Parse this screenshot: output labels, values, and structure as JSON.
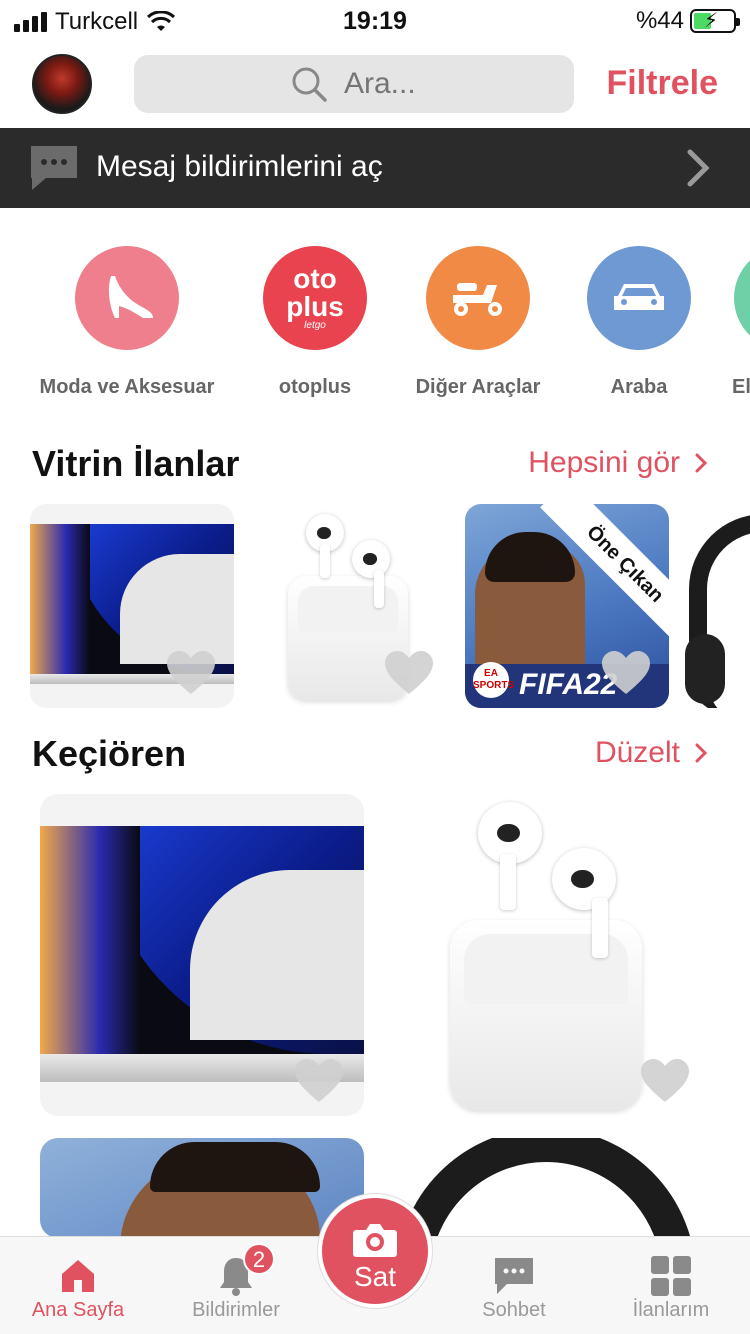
{
  "status_bar": {
    "carrier": "Turkcell",
    "time": "19:19",
    "battery": "%44"
  },
  "topbar": {
    "search_placeholder": "Ara...",
    "filter_label": "Filtrele"
  },
  "banner": {
    "text": "Mesaj bildirimlerini aç"
  },
  "categories": [
    {
      "label": "Moda ve Aksesuar",
      "color": "#ef7f8c",
      "icon": "high-heel-icon"
    },
    {
      "label": "otoplus",
      "color": "#e8434f",
      "icon": "otoplus-logo",
      "logo_top": "oto",
      "logo_bottom": "plus",
      "logo_small": "letgo"
    },
    {
      "label": "Diğer Araçlar",
      "color": "#f08a45",
      "icon": "scooter-icon"
    },
    {
      "label": "Araba",
      "color": "#6f99d3",
      "icon": "car-icon"
    },
    {
      "label": "El",
      "color": "#6fcfa6",
      "icon": "electronics-icon"
    }
  ],
  "vitrin": {
    "title": "Vitrin İlanlar",
    "link": "Hepsini gör",
    "items": [
      {
        "name": "macbook"
      },
      {
        "name": "airpods"
      },
      {
        "name": "fifa-22",
        "ribbon": "Öne Çıkan",
        "game_title": "FIFA22",
        "publisher": "EA SPORTS"
      },
      {
        "name": "headphones"
      }
    ]
  },
  "location": {
    "title": "Keçiören",
    "link": "Düzelt"
  },
  "tabbar": {
    "tabs": [
      {
        "label": "Ana Sayfa",
        "active": true
      },
      {
        "label": "Bildirimler",
        "badge": "2"
      },
      {
        "label": "Sohbet"
      },
      {
        "label": "İlanlarım"
      }
    ],
    "sell_label": "Sat"
  },
  "colors": {
    "accent": "#e05260",
    "banner_bg": "#2b2b2b"
  }
}
